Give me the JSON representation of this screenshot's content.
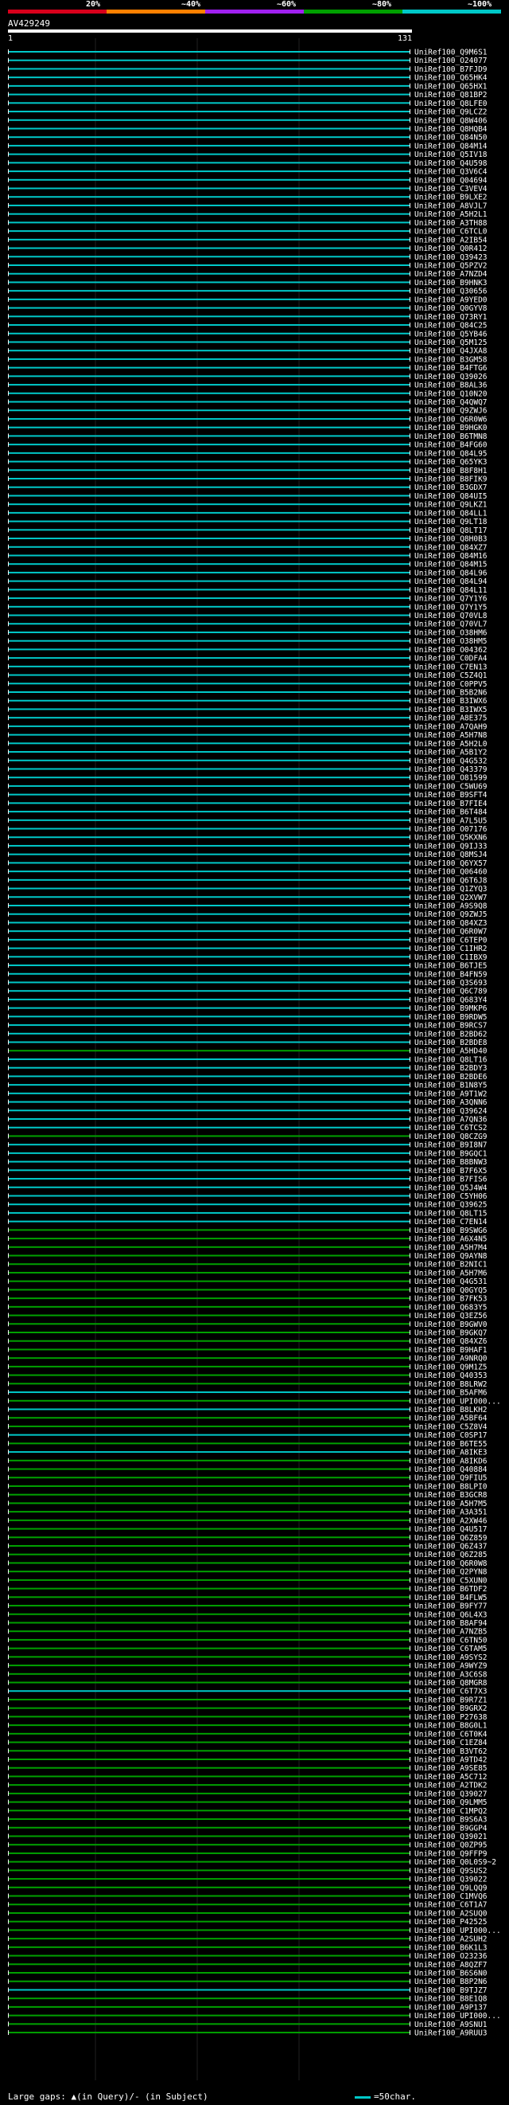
{
  "legend": {
    "bar_colors": [
      "#d8001b",
      "#ff8000",
      "#a020f0",
      "#00a000",
      "#00c8c8"
    ],
    "labels": [
      "20%",
      "~40%",
      "~60%",
      "~80%",
      "~100%"
    ]
  },
  "query": {
    "id": "AV429249",
    "start": "1",
    "end": "131"
  },
  "footer": {
    "gaps_text": "Large gaps: ▲(in Query)/- (in Subject)",
    "scale_text": "=50char."
  },
  "hits": [
    {
      "label": "UniRef100_Q9M6S1",
      "color": "#00c8c8"
    },
    {
      "label": "UniRef100_O24077",
      "color": "#00c8c8"
    },
    {
      "label": "UniRef100_B7FJD9",
      "color": "#00c8c8"
    },
    {
      "label": "UniRef100_Q65HK4",
      "color": "#00c8c8"
    },
    {
      "label": "UniRef100_Q65HX1",
      "color": "#00c8c8"
    },
    {
      "label": "UniRef100_Q81BP2",
      "color": "#00c8c8"
    },
    {
      "label": "UniRef100_Q8LFE0",
      "color": "#00c8c8"
    },
    {
      "label": "UniRef100_Q9LCZ2",
      "color": "#00c8c8"
    },
    {
      "label": "UniRef100_Q8W406",
      "color": "#00c8c8"
    },
    {
      "label": "UniRef100_Q8HQB4",
      "color": "#00c8c8"
    },
    {
      "label": "UniRef100_Q84N50",
      "color": "#00c8c8"
    },
    {
      "label": "UniRef100_Q84M14",
      "color": "#00c8c8"
    },
    {
      "label": "UniRef100_Q5IV18",
      "color": "#00c8c8"
    },
    {
      "label": "UniRef100_Q4U598",
      "color": "#00c8c8"
    },
    {
      "label": "UniRef100_Q3V6C4",
      "color": "#00c8c8"
    },
    {
      "label": "UniRef100_Q04694",
      "color": "#00c8c8"
    },
    {
      "label": "UniRef100_C3VEV4",
      "color": "#00c8c8"
    },
    {
      "label": "UniRef100_B9LXE2",
      "color": "#00c8c8"
    },
    {
      "label": "UniRef100_A8VJL7",
      "color": "#00c8c8"
    },
    {
      "label": "UniRef100_A5H2L1",
      "color": "#00c8c8"
    },
    {
      "label": "UniRef100_A3TH88",
      "color": "#00c8c8"
    },
    {
      "label": "UniRef100_C6TCL0",
      "color": "#00c8c8"
    },
    {
      "label": "UniRef100_A2IB54",
      "color": "#00c8c8"
    },
    {
      "label": "UniRef100_Q0R412",
      "color": "#00c8c8"
    },
    {
      "label": "UniRef100_Q39423",
      "color": "#00c8c8"
    },
    {
      "label": "UniRef100_Q5PZV2",
      "color": "#00c8c8"
    },
    {
      "label": "UniRef100_A7NZD4",
      "color": "#00c8c8"
    },
    {
      "label": "UniRef100_B9HNK3",
      "color": "#00c8c8"
    },
    {
      "label": "UniRef100_Q30656",
      "color": "#00c8c8"
    },
    {
      "label": "UniRef100_A9YED0",
      "color": "#00c8c8"
    },
    {
      "label": "UniRef100_Q0GYV8",
      "color": "#00c8c8"
    },
    {
      "label": "UniRef100_Q73RY1",
      "color": "#00c8c8"
    },
    {
      "label": "UniRef100_Q84C25",
      "color": "#00c8c8"
    },
    {
      "label": "UniRef100_Q5YB46",
      "color": "#00c8c8"
    },
    {
      "label": "UniRef100_Q5M125",
      "color": "#00c8c8"
    },
    {
      "label": "UniRef100_Q4JXA8",
      "color": "#00c8c8"
    },
    {
      "label": "UniRef100_B3GM58",
      "color": "#00c8c8"
    },
    {
      "label": "UniRef100_B4FTG6",
      "color": "#00c8c8"
    },
    {
      "label": "UniRef100_Q39026",
      "color": "#00c8c8"
    },
    {
      "label": "UniRef100_B8AL36",
      "color": "#00c8c8"
    },
    {
      "label": "UniRef100_Q10N20",
      "color": "#00c8c8"
    },
    {
      "label": "UniRef100_Q4QWQ7",
      "color": "#00c8c8"
    },
    {
      "label": "UniRef100_Q9ZWJ6",
      "color": "#00c8c8"
    },
    {
      "label": "UniRef100_Q6R0W6",
      "color": "#00c8c8"
    },
    {
      "label": "UniRef100_B9HGK0",
      "color": "#00c8c8"
    },
    {
      "label": "UniRef100_B6TMN8",
      "color": "#00c8c8"
    },
    {
      "label": "UniRef100_B4FG60",
      "color": "#00c8c8"
    },
    {
      "label": "UniRef100_Q84L95",
      "color": "#00c8c8"
    },
    {
      "label": "UniRef100_Q65YK3",
      "color": "#00c8c8"
    },
    {
      "label": "UniRef100_B8F8H1",
      "color": "#00c8c8"
    },
    {
      "label": "UniRef100_B8FIK9",
      "color": "#00c8c8"
    },
    {
      "label": "UniRef100_B3GDX7",
      "color": "#00c8c8"
    },
    {
      "label": "UniRef100_Q84UI5",
      "color": "#00c8c8"
    },
    {
      "label": "UniRef100_Q9LKZ1",
      "color": "#00c8c8"
    },
    {
      "label": "UniRef100_Q84LL1",
      "color": "#00c8c8"
    },
    {
      "label": "UniRef100_Q9LT18",
      "color": "#00c8c8"
    },
    {
      "label": "UniRef100_Q8LT17",
      "color": "#00c8c8"
    },
    {
      "label": "UniRef100_Q8H0B3",
      "color": "#00c8c8"
    },
    {
      "label": "UniRef100_Q84XZ7",
      "color": "#00c8c8"
    },
    {
      "label": "UniRef100_Q84M16",
      "color": "#00c8c8"
    },
    {
      "label": "UniRef100_Q84M15",
      "color": "#00c8c8"
    },
    {
      "label": "UniRef100_Q84L96",
      "color": "#00c8c8"
    },
    {
      "label": "UniRef100_Q84L94",
      "color": "#00c8c8"
    },
    {
      "label": "UniRef100_Q84L11",
      "color": "#00c8c8"
    },
    {
      "label": "UniRef100_Q7Y1Y6",
      "color": "#00c8c8"
    },
    {
      "label": "UniRef100_Q7Y1Y5",
      "color": "#00c8c8"
    },
    {
      "label": "UniRef100_Q70VL8",
      "color": "#00c8c8"
    },
    {
      "label": "UniRef100_Q70VL7",
      "color": "#00c8c8"
    },
    {
      "label": "UniRef100_O38HM6",
      "color": "#00c8c8"
    },
    {
      "label": "UniRef100_O38HM5",
      "color": "#00c8c8"
    },
    {
      "label": "UniRef100_O04362",
      "color": "#00c8c8"
    },
    {
      "label": "UniRef100_C0DFA4",
      "color": "#00c8c8"
    },
    {
      "label": "UniRef100_C7EN13",
      "color": "#00c8c8"
    },
    {
      "label": "UniRef100_C5Z4Q1",
      "color": "#00c8c8"
    },
    {
      "label": "UniRef100_C0PPV5",
      "color": "#00c8c8"
    },
    {
      "label": "UniRef100_B5B2N6",
      "color": "#00c8c8"
    },
    {
      "label": "UniRef100_B3IWX6",
      "color": "#00c8c8"
    },
    {
      "label": "UniRef100_B3IWX5",
      "color": "#00c8c8"
    },
    {
      "label": "UniRef100_A8E375",
      "color": "#00c8c8"
    },
    {
      "label": "UniRef100_A7QAH9",
      "color": "#00c8c8"
    },
    {
      "label": "UniRef100_A5H7N8",
      "color": "#00c8c8"
    },
    {
      "label": "UniRef100_A5H2L0",
      "color": "#00c8c8"
    },
    {
      "label": "UniRef100_A5B1Y2",
      "color": "#00c8c8"
    },
    {
      "label": "UniRef100_Q4G532",
      "color": "#00c8c8"
    },
    {
      "label": "UniRef100_Q43379",
      "color": "#00c8c8"
    },
    {
      "label": "UniRef100_O81599",
      "color": "#00c8c8"
    },
    {
      "label": "UniRef100_C5WU69",
      "color": "#00c8c8"
    },
    {
      "label": "UniRef100_B9SFT4",
      "color": "#00c8c8"
    },
    {
      "label": "UniRef100_B7FIE4",
      "color": "#00c8c8"
    },
    {
      "label": "UniRef100_B6T484",
      "color": "#00c8c8"
    },
    {
      "label": "UniRef100_A7L5U5",
      "color": "#00c8c8"
    },
    {
      "label": "UniRef100_O07176",
      "color": "#00c8c8"
    },
    {
      "label": "UniRef100_Q5KXN6",
      "color": "#00c8c8"
    },
    {
      "label": "UniRef100_Q9IJ33",
      "color": "#00c8c8"
    },
    {
      "label": "UniRef100_Q8MSJ4",
      "color": "#00c8c8"
    },
    {
      "label": "UniRef100_Q6YX57",
      "color": "#00c8c8"
    },
    {
      "label": "UniRef100_Q06460",
      "color": "#00c8c8"
    },
    {
      "label": "UniRef100_Q6T6J8",
      "color": "#00c8c8"
    },
    {
      "label": "UniRef100_Q1ZYQ3",
      "color": "#00c8c8"
    },
    {
      "label": "UniRef100_Q2XVW7",
      "color": "#00c8c8"
    },
    {
      "label": "UniRef100_A9S9Q8",
      "color": "#00c8c8"
    },
    {
      "label": "UniRef100_Q9ZWJ5",
      "color": "#00c8c8"
    },
    {
      "label": "UniRef100_Q84XZ3",
      "color": "#00c8c8"
    },
    {
      "label": "UniRef100_Q6R0W7",
      "color": "#00c8c8"
    },
    {
      "label": "UniRef100_C6TEP0",
      "color": "#00c8c8"
    },
    {
      "label": "UniRef100_C1IHR2",
      "color": "#00c8c8"
    },
    {
      "label": "UniRef100_C1IBX9",
      "color": "#00c8c8"
    },
    {
      "label": "UniRef100_B6TJE5",
      "color": "#00c8c8"
    },
    {
      "label": "UniRef100_B4FN59",
      "color": "#00c8c8"
    },
    {
      "label": "UniRef100_Q3S693",
      "color": "#00c8c8"
    },
    {
      "label": "UniRef100_Q6C789",
      "color": "#00c8c8"
    },
    {
      "label": "UniRef100_Q683Y4",
      "color": "#00c8c8"
    },
    {
      "label": "UniRef100_B9MKP6",
      "color": "#00c8c8"
    },
    {
      "label": "UniRef100_B9RDW5",
      "color": "#00c8c8"
    },
    {
      "label": "UniRef100_B9RCS7",
      "color": "#00c8c8"
    },
    {
      "label": "UniRef100_B2BD62",
      "color": "#00c8c8"
    },
    {
      "label": "UniRef100_B2BDE8",
      "color": "#00c8c8"
    },
    {
      "label": "UniRef100_A5HD40",
      "color": "#00a000"
    },
    {
      "label": "UniRef100_Q8LT16",
      "color": "#00c8c8"
    },
    {
      "label": "UniRef100_B2BDY3",
      "color": "#00c8c8"
    },
    {
      "label": "UniRef100_B2BDE6",
      "color": "#00c8c8"
    },
    {
      "label": "UniRef100_B1N8Y5",
      "color": "#00c8c8"
    },
    {
      "label": "UniRef100_A9T1W2",
      "color": "#00c8c8"
    },
    {
      "label": "UniRef100_A3QNN6",
      "color": "#00c8c8"
    },
    {
      "label": "UniRef100_Q39624",
      "color": "#00c8c8"
    },
    {
      "label": "UniRef100_A7QN36",
      "color": "#00c8c8"
    },
    {
      "label": "UniRef100_C6TCS2",
      "color": "#00c8c8"
    },
    {
      "label": "UniRef100_Q8CZG9",
      "color": "#00a000"
    },
    {
      "label": "UniRef100_B9I8N7",
      "color": "#00c8c8"
    },
    {
      "label": "UniRef100_B9GQC1",
      "color": "#00c8c8"
    },
    {
      "label": "UniRef100_B8BNW3",
      "color": "#00c8c8"
    },
    {
      "label": "UniRef100_B7F6X5",
      "color": "#00c8c8"
    },
    {
      "label": "UniRef100_B7FIS6",
      "color": "#00c8c8"
    },
    {
      "label": "UniRef100_Q5J4W4",
      "color": "#00c8c8"
    },
    {
      "label": "UniRef100_C5YH06",
      "color": "#00c8c8"
    },
    {
      "label": "UniRef100_Q39625",
      "color": "#00c8c8"
    },
    {
      "label": "UniRef100_Q8LT15",
      "color": "#00c8c8"
    },
    {
      "label": "UniRef100_C7EN14",
      "color": "#00c8c8"
    },
    {
      "label": "UniRef100_B9SWG6",
      "color": "#00a000"
    },
    {
      "label": "UniRef100_A6X4N5",
      "color": "#00a000"
    },
    {
      "label": "UniRef100_A5H7M4",
      "color": "#00a000"
    },
    {
      "label": "UniRef100_Q9AYN8",
      "color": "#00a000"
    },
    {
      "label": "UniRef100_B2NIC1",
      "color": "#00a000"
    },
    {
      "label": "UniRef100_A5H7M6",
      "color": "#00a000"
    },
    {
      "label": "UniRef100_Q4G531",
      "color": "#00a000"
    },
    {
      "label": "UniRef100_Q0GYQ5",
      "color": "#00a000"
    },
    {
      "label": "UniRef100_B7FK53",
      "color": "#00a000"
    },
    {
      "label": "UniRef100_Q683Y5",
      "color": "#00a000"
    },
    {
      "label": "UniRef100_Q3EZ56",
      "color": "#00a000"
    },
    {
      "label": "UniRef100_B9GWV0",
      "color": "#00a000"
    },
    {
      "label": "UniRef100_B9GKQ7",
      "color": "#00a000"
    },
    {
      "label": "UniRef100_Q84XZ6",
      "color": "#00a000"
    },
    {
      "label": "UniRef100_B9HAF1",
      "color": "#00a000"
    },
    {
      "label": "UniRef100_A9NRQ0",
      "color": "#00a000"
    },
    {
      "label": "UniRef100_Q9M1Z5",
      "color": "#00a000"
    },
    {
      "label": "UniRef100_Q40353",
      "color": "#00a000"
    },
    {
      "label": "UniRef100_B8LRW2",
      "color": "#00a000"
    },
    {
      "label": "UniRef100_B5AFM6",
      "color": "#00c8c8"
    },
    {
      "label": "UniRef100_UPI000...",
      "color": "#00a000"
    },
    {
      "label": "UniRef100_B8LKH2",
      "color": "#00c8c8"
    },
    {
      "label": "UniRef100_A5BF64",
      "color": "#00a000"
    },
    {
      "label": "UniRef100_C5Z8V4",
      "color": "#00a000"
    },
    {
      "label": "UniRef100_C0SP17",
      "color": "#00c8c8"
    },
    {
      "label": "UniRef100_B6TE55",
      "color": "#00a000"
    },
    {
      "label": "UniRef100_A8IKE3",
      "color": "#00c8c8"
    },
    {
      "label": "UniRef100_A8IKD6",
      "color": "#00a000"
    },
    {
      "label": "UniRef100_Q40884",
      "color": "#00a000"
    },
    {
      "label": "UniRef100_Q9FIU5",
      "color": "#00a000"
    },
    {
      "label": "UniRef100_B8LPI0",
      "color": "#00a000"
    },
    {
      "label": "UniRef100_B3GCR8",
      "color": "#00a000"
    },
    {
      "label": "UniRef100_A5H7M5",
      "color": "#00a000"
    },
    {
      "label": "UniRef100_A3A351",
      "color": "#00a000"
    },
    {
      "label": "UniRef100_A2XW46",
      "color": "#00a000"
    },
    {
      "label": "UniRef100_Q4U517",
      "color": "#00a000"
    },
    {
      "label": "UniRef100_Q6Z859",
      "color": "#00a000"
    },
    {
      "label": "UniRef100_Q6Z437",
      "color": "#00a000"
    },
    {
      "label": "UniRef100_Q6Z285",
      "color": "#00a000"
    },
    {
      "label": "UniRef100_Q6R0W8",
      "color": "#00a000"
    },
    {
      "label": "UniRef100_Q2PYN8",
      "color": "#00a000"
    },
    {
      "label": "UniRef100_C5XUN0",
      "color": "#00a000"
    },
    {
      "label": "UniRef100_B6TDF2",
      "color": "#00a000"
    },
    {
      "label": "UniRef100_B4FLW5",
      "color": "#00a000"
    },
    {
      "label": "UniRef100_B9FY77",
      "color": "#00a000"
    },
    {
      "label": "UniRef100_Q6L4X3",
      "color": "#00a000"
    },
    {
      "label": "UniRef100_B8AF94",
      "color": "#00a000"
    },
    {
      "label": "UniRef100_A7NZB5",
      "color": "#00a000"
    },
    {
      "label": "UniRef100_C6TN50",
      "color": "#00a000"
    },
    {
      "label": "UniRef100_C6TAM5",
      "color": "#00a000"
    },
    {
      "label": "UniRef100_A9SYS2",
      "color": "#00a000"
    },
    {
      "label": "UniRef100_A9WYZ9",
      "color": "#00a000"
    },
    {
      "label": "UniRef100_A3C6S8",
      "color": "#00a000"
    },
    {
      "label": "UniRef100_Q8MGR8",
      "color": "#00a000"
    },
    {
      "label": "UniRef100_C6T7X3",
      "color": "#00c8c8"
    },
    {
      "label": "UniRef100_B9R7Z1",
      "color": "#00a000"
    },
    {
      "label": "UniRef100_B9GRX2",
      "color": "#00a000"
    },
    {
      "label": "UniRef100_P27638",
      "color": "#00a000"
    },
    {
      "label": "UniRef100_B8G0L1",
      "color": "#00a000"
    },
    {
      "label": "UniRef100_C6T0K4",
      "color": "#00a000"
    },
    {
      "label": "UniRef100_C1EZ84",
      "color": "#00a000"
    },
    {
      "label": "UniRef100_B3VT62",
      "color": "#00a000"
    },
    {
      "label": "UniRef100_A9TD42",
      "color": "#00a000"
    },
    {
      "label": "UniRef100_A9SE85",
      "color": "#00a000"
    },
    {
      "label": "UniRef100_A5C712",
      "color": "#00a000"
    },
    {
      "label": "UniRef100_A2TDK2",
      "color": "#00a000"
    },
    {
      "label": "UniRef100_Q39027",
      "color": "#00a000"
    },
    {
      "label": "UniRef100_Q9LMM5",
      "color": "#00a000"
    },
    {
      "label": "UniRef100_C1MPQ2",
      "color": "#00a000"
    },
    {
      "label": "UniRef100_B9S6A3",
      "color": "#00a000"
    },
    {
      "label": "UniRef100_B9GGP4",
      "color": "#00a000"
    },
    {
      "label": "UniRef100_Q39021",
      "color": "#00a000"
    },
    {
      "label": "UniRef100_Q0ZP95",
      "color": "#00a000"
    },
    {
      "label": "UniRef100_Q9FFP9",
      "color": "#00a000"
    },
    {
      "label": "UniRef100_Q0L0S9~2",
      "color": "#00a000"
    },
    {
      "label": "UniRef100_Q9SUS2",
      "color": "#00a000"
    },
    {
      "label": "UniRef100_Q39022",
      "color": "#00a000"
    },
    {
      "label": "UniRef100_Q9LQQ9",
      "color": "#00a000"
    },
    {
      "label": "UniRef100_C1MVQ6",
      "color": "#00a000"
    },
    {
      "label": "UniRef100_C6T1A7",
      "color": "#00a000"
    },
    {
      "label": "UniRef100_A2SUQ0",
      "color": "#00a000"
    },
    {
      "label": "UniRef100_P42525",
      "color": "#00a000"
    },
    {
      "label": "UniRef100_UPI000...",
      "color": "#00a000"
    },
    {
      "label": "UniRef100_A2SUH2",
      "color": "#00a000"
    },
    {
      "label": "UniRef100_B6K1L3",
      "color": "#00a000"
    },
    {
      "label": "UniRef100_O23236",
      "color": "#00a000"
    },
    {
      "label": "UniRef100_A8QZF7",
      "color": "#00a000"
    },
    {
      "label": "UniRef100_B6S6N0",
      "color": "#00a000"
    },
    {
      "label": "UniRef100_B8P2N6",
      "color": "#00a000"
    },
    {
      "label": "UniRef100_B9TJZ7",
      "color": "#00c8c8"
    },
    {
      "label": "UniRef100_B8E1Q8",
      "color": "#00a000"
    },
    {
      "label": "UniRef100_A9P137",
      "color": "#00a000"
    },
    {
      "label": "UniRef100_UPI000...",
      "color": "#00a000"
    },
    {
      "label": "UniRef100_A9SNU1",
      "color": "#00a000"
    },
    {
      "label": "UniRef100_A9RUU3",
      "color": "#00a000"
    }
  ]
}
